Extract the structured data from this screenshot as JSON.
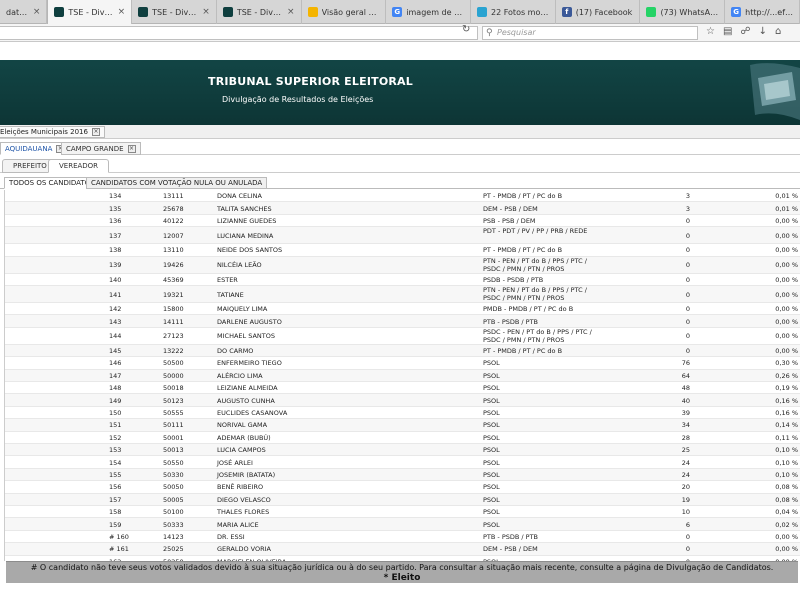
{
  "browser": {
    "tabs": [
      {
        "title": "dato à r...",
        "fav_color": "#777777",
        "fav_glyph": "",
        "active": false
      },
      {
        "title": "TSE - Divulgação ...",
        "fav_color": "#0f3f3f",
        "fav_glyph": "",
        "active": true
      },
      {
        "title": "TSE - Divulgação ...",
        "fav_color": "#0f3f3f",
        "fav_glyph": "",
        "active": false
      },
      {
        "title": "TSE - Divulgação ...",
        "fav_color": "#0f3f3f",
        "fav_glyph": "",
        "active": false
      },
      {
        "title": "Visão geral - ...",
        "fav_color": "#f4b400",
        "fav_glyph": "",
        "active": false
      },
      {
        "title": "imagem de h...",
        "fav_color": "#4285f4",
        "fav_glyph": "G",
        "active": false
      },
      {
        "title": "22 Fotos mos...",
        "fav_color": "#29a3d1",
        "fav_glyph": "",
        "active": false
      },
      {
        "title": "(17) Facebook",
        "fav_color": "#3b5998",
        "fav_glyph": "f",
        "active": false
      },
      {
        "title": "(73) WhatsApp",
        "fav_color": "#25d366",
        "fav_glyph": "",
        "active": false
      },
      {
        "title": "http://...efeitos",
        "fav_color": "#4285f4",
        "fav_glyph": "G",
        "active": false
      }
    ],
    "search_placeholder": "Pesquisar"
  },
  "header": {
    "title": "TRIBUNAL SUPERIOR ELEITORAL",
    "subtitle": "Divulgação de Resultados de Eleições"
  },
  "election_tab": "Eleições Municipais 2016",
  "city_tabs": [
    {
      "label": "AQUIDAUANA",
      "active": true
    },
    {
      "label": "CAMPO GRANDE",
      "active": false
    }
  ],
  "office_tabs": [
    {
      "label": "PREFEITO",
      "active": false
    },
    {
      "label": "VEREADOR",
      "active": true
    }
  ],
  "sub_tabs": [
    {
      "label": "TODOS OS CANDIDATOS",
      "active": true
    },
    {
      "label": "CANDIDATOS COM VOTAÇÃO NULA OU ANULADA",
      "active": false
    }
  ],
  "table": {
    "rows": [
      {
        "seq": "134",
        "num": "13111",
        "name": "DONA CELINA",
        "party": "PT - PMDB / PT / PC do B",
        "votes": "3",
        "pct": "0,01 %"
      },
      {
        "seq": "135",
        "num": "25678",
        "name": "TALITA SANCHES",
        "party": "DEM - PSB / DEM",
        "votes": "3",
        "pct": "0,01 %"
      },
      {
        "seq": "136",
        "num": "40122",
        "name": "LIZIANNE GUEDES",
        "party": "PSB - PSB / DEM",
        "votes": "0",
        "pct": "0,00 %"
      },
      {
        "seq": "137",
        "num": "12007",
        "name": "LUCIANA MEDINA",
        "party": "PDT - PDT / PV / PP / PRB / REDE",
        "votes": "0",
        "pct": "0,00 %"
      },
      {
        "seq": "138",
        "num": "13110",
        "name": "NEIDE DOS SANTOS",
        "party": "PT - PMDB / PT / PC do B",
        "votes": "0",
        "pct": "0,00 %"
      },
      {
        "seq": "139",
        "num": "19426",
        "name": "NILCÉIA LEÃO",
        "party": "PTN - PEN / PT do B / PPS / PTC / PSDC / PMN / PTN / PROS",
        "votes": "0",
        "pct": "0,00 %"
      },
      {
        "seq": "140",
        "num": "45369",
        "name": "ESTER",
        "party": "PSDB - PSDB / PTB",
        "votes": "0",
        "pct": "0,00 %"
      },
      {
        "seq": "141",
        "num": "19321",
        "name": "TATIANE",
        "party": "PTN - PEN / PT do B / PPS / PTC / PSDC / PMN / PTN / PROS",
        "votes": "0",
        "pct": "0,00 %"
      },
      {
        "seq": "142",
        "num": "15800",
        "name": "MAIQUELY LIMA",
        "party": "PMDB - PMDB / PT / PC do B",
        "votes": "0",
        "pct": "0,00 %"
      },
      {
        "seq": "143",
        "num": "14111",
        "name": "DARLENE AUGUSTO",
        "party": "PTB - PSDB / PTB",
        "votes": "0",
        "pct": "0,00 %"
      },
      {
        "seq": "144",
        "num": "27123",
        "name": "MICHAEL SANTOS",
        "party": "PSDC - PEN / PT do B / PPS / PTC / PSDC / PMN / PTN / PROS",
        "votes": "0",
        "pct": "0,00 %"
      },
      {
        "seq": "145",
        "num": "13222",
        "name": "DO CARMO",
        "party": "PT - PMDB / PT / PC do B",
        "votes": "0",
        "pct": "0,00 %"
      },
      {
        "seq": "146",
        "num": "50500",
        "name": "ENFERMEIRO TIEGO",
        "party": "PSOL",
        "votes": "76",
        "pct": "0,30 %"
      },
      {
        "seq": "147",
        "num": "50000",
        "name": "ALÉRCIO LIMA",
        "party": "PSOL",
        "votes": "64",
        "pct": "0,26 %"
      },
      {
        "seq": "148",
        "num": "50018",
        "name": "LEIZIANE ALMEIDA",
        "party": "PSOL",
        "votes": "48",
        "pct": "0,19 %"
      },
      {
        "seq": "149",
        "num": "50123",
        "name": "AUGUSTO CUNHA",
        "party": "PSOL",
        "votes": "40",
        "pct": "0,16 %"
      },
      {
        "seq": "150",
        "num": "50555",
        "name": "EUCLIDES CASANOVA",
        "party": "PSOL",
        "votes": "39",
        "pct": "0,16 %"
      },
      {
        "seq": "151",
        "num": "50111",
        "name": "NORIVAL GAMA",
        "party": "PSOL",
        "votes": "34",
        "pct": "0,14 %"
      },
      {
        "seq": "152",
        "num": "50001",
        "name": "ADEMAR (BUBÚ)",
        "party": "PSOL",
        "votes": "28",
        "pct": "0,11 %"
      },
      {
        "seq": "153",
        "num": "50013",
        "name": "LUCIA CAMPOS",
        "party": "PSOL",
        "votes": "25",
        "pct": "0,10 %"
      },
      {
        "seq": "154",
        "num": "50550",
        "name": "JOSÉ ARLEI",
        "party": "PSOL",
        "votes": "24",
        "pct": "0,10 %"
      },
      {
        "seq": "155",
        "num": "50330",
        "name": "JOSEMIR (BATATA)",
        "party": "PSOL",
        "votes": "24",
        "pct": "0,10 %"
      },
      {
        "seq": "156",
        "num": "50050",
        "name": "BENÊ RIBEIRO",
        "party": "PSOL",
        "votes": "20",
        "pct": "0,08 %"
      },
      {
        "seq": "157",
        "num": "50005",
        "name": "DIEGO VELASCO",
        "party": "PSOL",
        "votes": "19",
        "pct": "0,08 %"
      },
      {
        "seq": "158",
        "num": "50100",
        "name": "THALES FLORES",
        "party": "PSOL",
        "votes": "10",
        "pct": "0,04 %"
      },
      {
        "seq": "159",
        "num": "50333",
        "name": "MARIA ALICE",
        "party": "PSOL",
        "votes": "6",
        "pct": "0,02 %"
      },
      {
        "seq": "# 160",
        "num": "14123",
        "name": "DR. ESSI",
        "party": "PTB - PSDB / PTB",
        "votes": "0",
        "pct": "0,00 %"
      },
      {
        "seq": "# 161",
        "num": "25025",
        "name": "GERALDO VORIA",
        "party": "DEM - PSB / DEM",
        "votes": "0",
        "pct": "0,00 %"
      },
      {
        "seq": "162",
        "num": "50250",
        "name": "MARCIELEN OLIVEIRA",
        "party": "PSOL",
        "votes": "0",
        "pct": "0,00 %"
      }
    ]
  },
  "footer": {
    "note": "# O candidato não teve seus votos validados devido à sua situação jurídica ou à do seu partido. Para consultar a situação mais recente, consulte a página de Divulgação de Candidatos.",
    "elected": "* Eleito"
  }
}
